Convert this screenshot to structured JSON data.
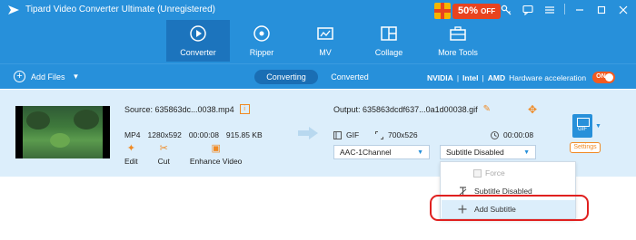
{
  "app": {
    "title": "Tipard Video Converter Ultimate (Unregistered)",
    "promo": {
      "percent": "50%",
      "suffix": "OFF"
    }
  },
  "window_controls": [
    "key-icon",
    "chat-icon",
    "menu-icon",
    "minimize-icon",
    "close-icon"
  ],
  "nav": {
    "tabs": [
      {
        "label": "Converter",
        "icon": "converter-icon",
        "active": true
      },
      {
        "label": "Ripper",
        "icon": "ripper-icon"
      },
      {
        "label": "MV",
        "icon": "mv-icon"
      },
      {
        "label": "Collage",
        "icon": "collage-icon"
      },
      {
        "label": "More Tools",
        "icon": "toolbox-icon"
      }
    ]
  },
  "toolbar": {
    "add_files": "Add Files",
    "converting": "Converting",
    "converted": "Converted",
    "hw_nvidia": "NVIDIA",
    "hw_sep1": "|",
    "hw_intel": "Intel",
    "hw_sep2": "|",
    "hw_amd": "AMD",
    "hw_label": "Hardware acceleration",
    "toggle": "ON"
  },
  "file": {
    "source_label": "Source: 635863dc...0038.mp4",
    "format": "MP4",
    "resolution": "1280x592",
    "duration": "00:00:08",
    "size": "915.85 KB",
    "actions": [
      {
        "label": "Edit",
        "icon": "edit-icon"
      },
      {
        "label": "Cut",
        "icon": "cut-icon"
      },
      {
        "label": "Enhance Video",
        "icon": "enhance-icon"
      }
    ],
    "output_label": "Output: 635863dcdf637...0a1d00038.gif",
    "out_format": "GIF",
    "out_resolution": "700x526",
    "out_duration": "00:00:08",
    "audio_select": "AAC-1Channel",
    "subtitle_select": "Subtitle Disabled",
    "format_badge": "GIF",
    "settings": "Settings"
  },
  "subtitle_menu": {
    "force": "Force",
    "disabled": "Subtitle Disabled",
    "add": "Add Subtitle"
  },
  "colors": {
    "header_blue": "#2790da",
    "accent_orange": "#f08a24",
    "toggle_orange": "#f35a1f",
    "highlight_red": "#e0201f"
  }
}
